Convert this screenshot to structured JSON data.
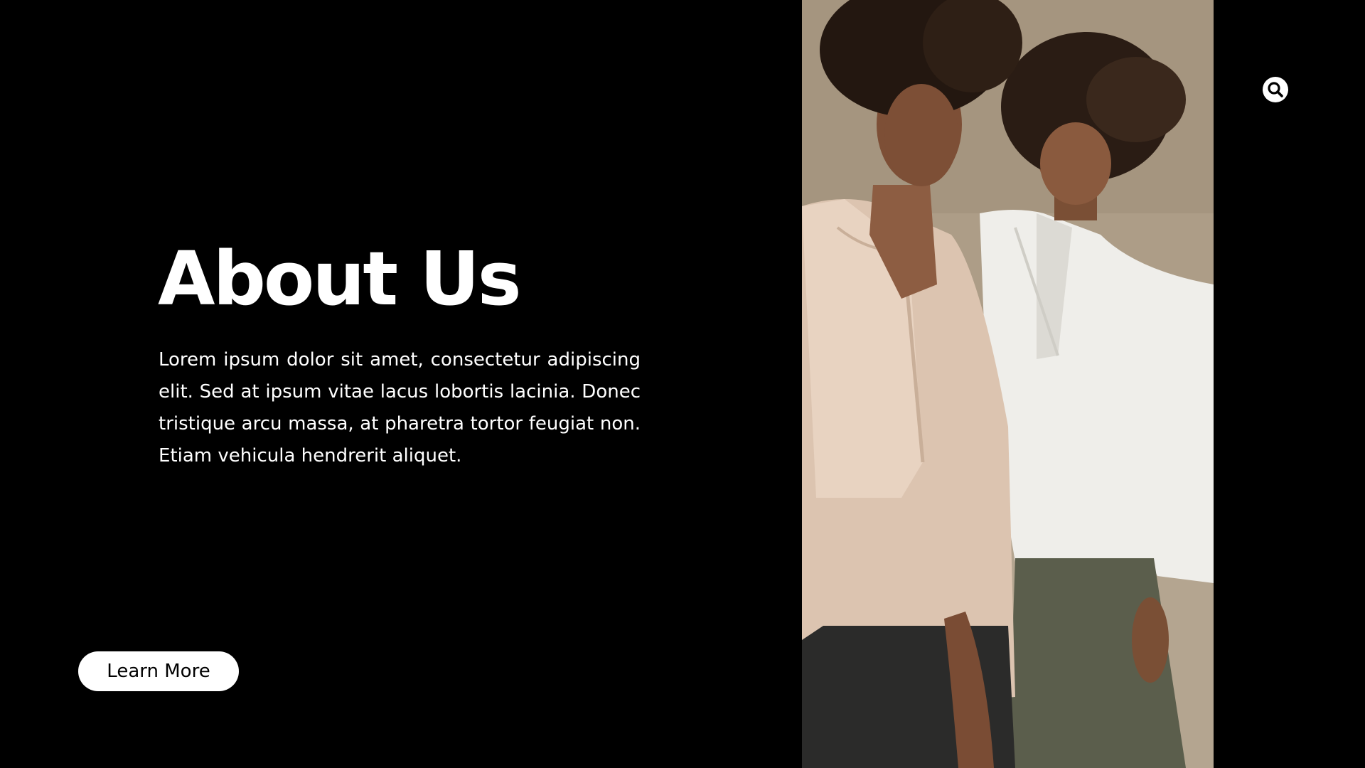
{
  "section": {
    "title": "About Us",
    "body": "Lorem ipsum dolor sit amet, consectetur adipiscing elit. Sed at ipsum vitae lacus lobortis lacinia. Donec tristique arcu massa, at pharetra tortor feugiat non. Etiam vehicula hendrerit aliquet."
  },
  "cta": {
    "label": "Learn More"
  },
  "icons": {
    "search": "search-icon"
  },
  "colors": {
    "background": "#000000",
    "text": "#ffffff",
    "button_bg": "#ffffff",
    "button_text": "#000000"
  }
}
